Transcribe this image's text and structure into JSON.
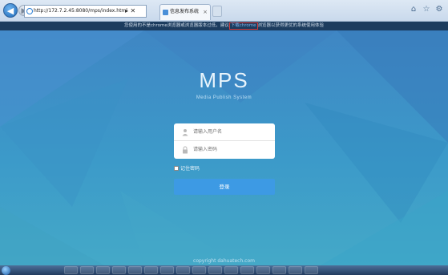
{
  "browser": {
    "url": "http://172.7.2.45:8080/mps/index.html",
    "address_tools": "▸ ✕",
    "tab_title": "信息发布系统",
    "tab_close": "×",
    "notice_before": "您使用的不是chrome浏览器或浏览器版本过低，建议",
    "notice_link": "下载chrome",
    "notice_after": "浏览器以获得更优的系统使用体验"
  },
  "app": {
    "title": "MPS",
    "subtitle": "Media Publish System",
    "username_placeholder": "请输入用户名",
    "password_placeholder": "请输入密码",
    "remember_label": "记住密码",
    "login_button": "登录",
    "copyright": "copyright dahuatech.com"
  }
}
